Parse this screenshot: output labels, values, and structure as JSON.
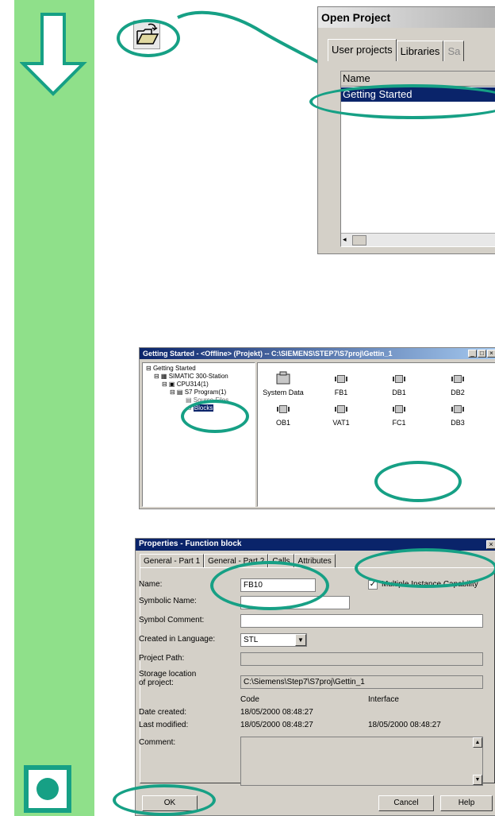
{
  "colors": {
    "sidebar": "#8fe08a",
    "accent": "#16a085",
    "dialog": "#d4d0c8"
  },
  "open_project": {
    "title": "Open Project",
    "tabs": [
      "User projects",
      "Libraries",
      "Sa"
    ],
    "column_header": "Name",
    "selected_item": "Getting Started"
  },
  "explorer": {
    "title": "Getting Started - <Offline> (Projekt) -- C:\\SIEMENS\\STEP7\\S7proj\\Gettin_1",
    "tree": [
      "Getting Started",
      "SIMATIC 300-Station",
      "CPU314(1)",
      "S7 Program(1)",
      "Source Files",
      "Blocks"
    ],
    "icons": [
      "System Data",
      "FB1",
      "DB1",
      "DB2",
      "OB1",
      "VAT1",
      "FC1",
      "DB3"
    ]
  },
  "properties": {
    "title": "Properties - Function block",
    "tabs": [
      "General - Part 1",
      "General - Part 2",
      "Calls",
      "Attributes"
    ],
    "name_label": "Name:",
    "name_value": "FB10",
    "multi_instance_label": "Multiple Instance Capability",
    "symbolic_name_label": "Symbolic Name:",
    "symbol_comment_label": "Symbol Comment:",
    "language_label": "Created in Language:",
    "language_value": "STL",
    "project_path_label": "Project Path:",
    "storage_label_1": "Storage location",
    "storage_label_2": "of project:",
    "storage_value": "C:\\Siemens\\Step7\\S7proj\\Gettin_1",
    "code_header": "Code",
    "interface_header": "Interface",
    "date_created_label": "Date created:",
    "date_created_code": "18/05/2000  08:48:27",
    "last_modified_label": "Last modified:",
    "last_modified_code": "18/05/2000  08:48:27",
    "last_modified_interface": "18/05/2000  08:48:27",
    "comment_label": "Comment:",
    "ok_label": "OK",
    "cancel_label": "Cancel",
    "help_label": "Help"
  }
}
